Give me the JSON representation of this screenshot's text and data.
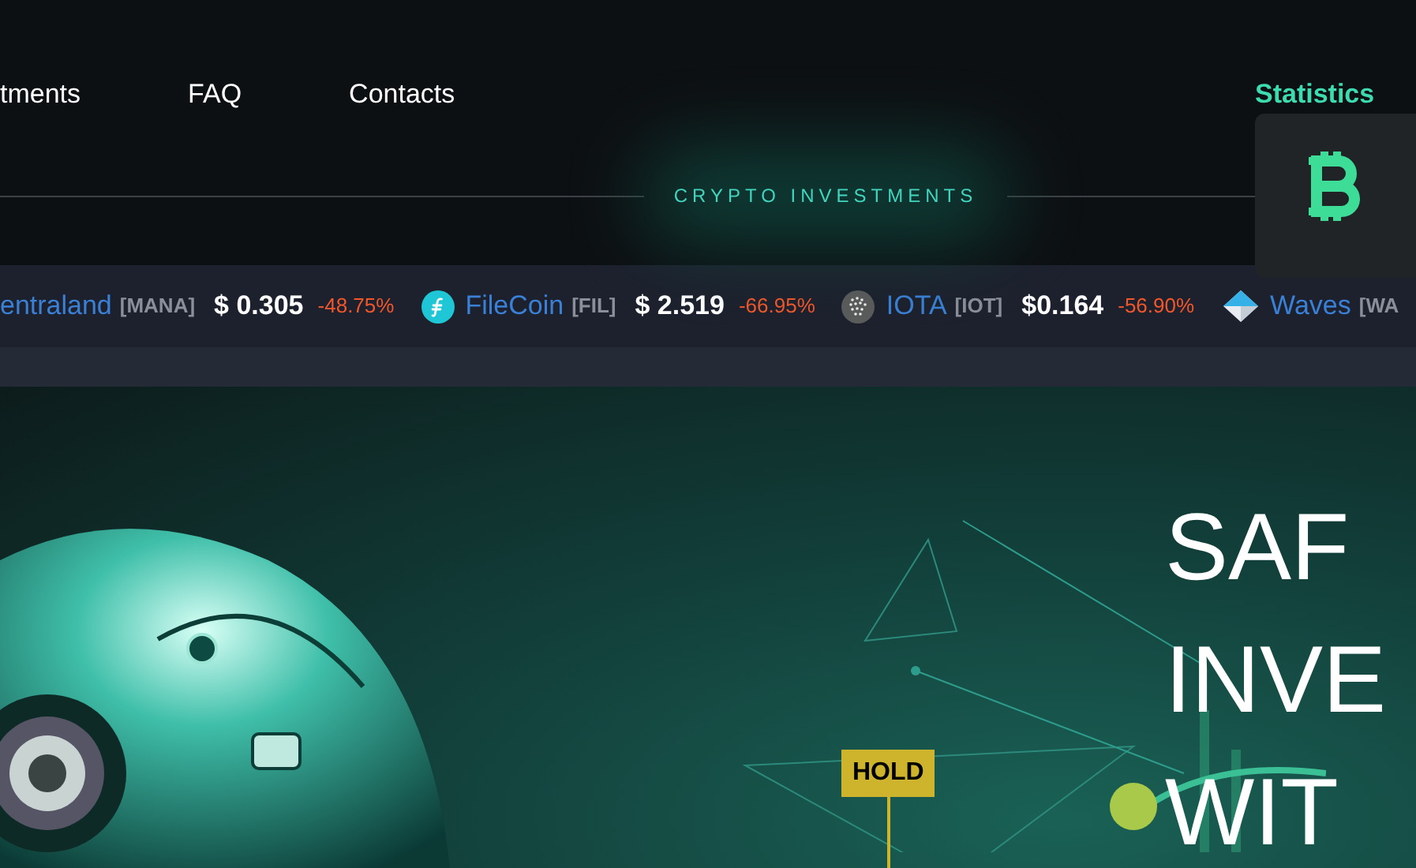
{
  "nav": {
    "items": [
      {
        "label": "tments",
        "selected": false
      },
      {
        "label": "FAQ",
        "selected": false
      },
      {
        "label": "Contacts",
        "selected": false
      }
    ],
    "statistics": {
      "label": "Statistics",
      "selected": true
    }
  },
  "section_label": "CRYPTO INVESTMENTS",
  "ticker": [
    {
      "name": "entraland",
      "symbol": "[MANA]",
      "price": "$ 0.305",
      "change": "-48.75%"
    },
    {
      "name": "FileCoin",
      "symbol": "[FIL]",
      "price": "$ 2.519",
      "change": "-66.95%"
    },
    {
      "name": "IOTA",
      "symbol": "[IOT]",
      "price": "$0.164",
      "change": "-56.90%"
    },
    {
      "name": "Waves",
      "symbol": "[WA"
    }
  ],
  "hero": {
    "sign": "HOLD",
    "headline": [
      "SAF",
      "INVE",
      "WIT"
    ]
  }
}
